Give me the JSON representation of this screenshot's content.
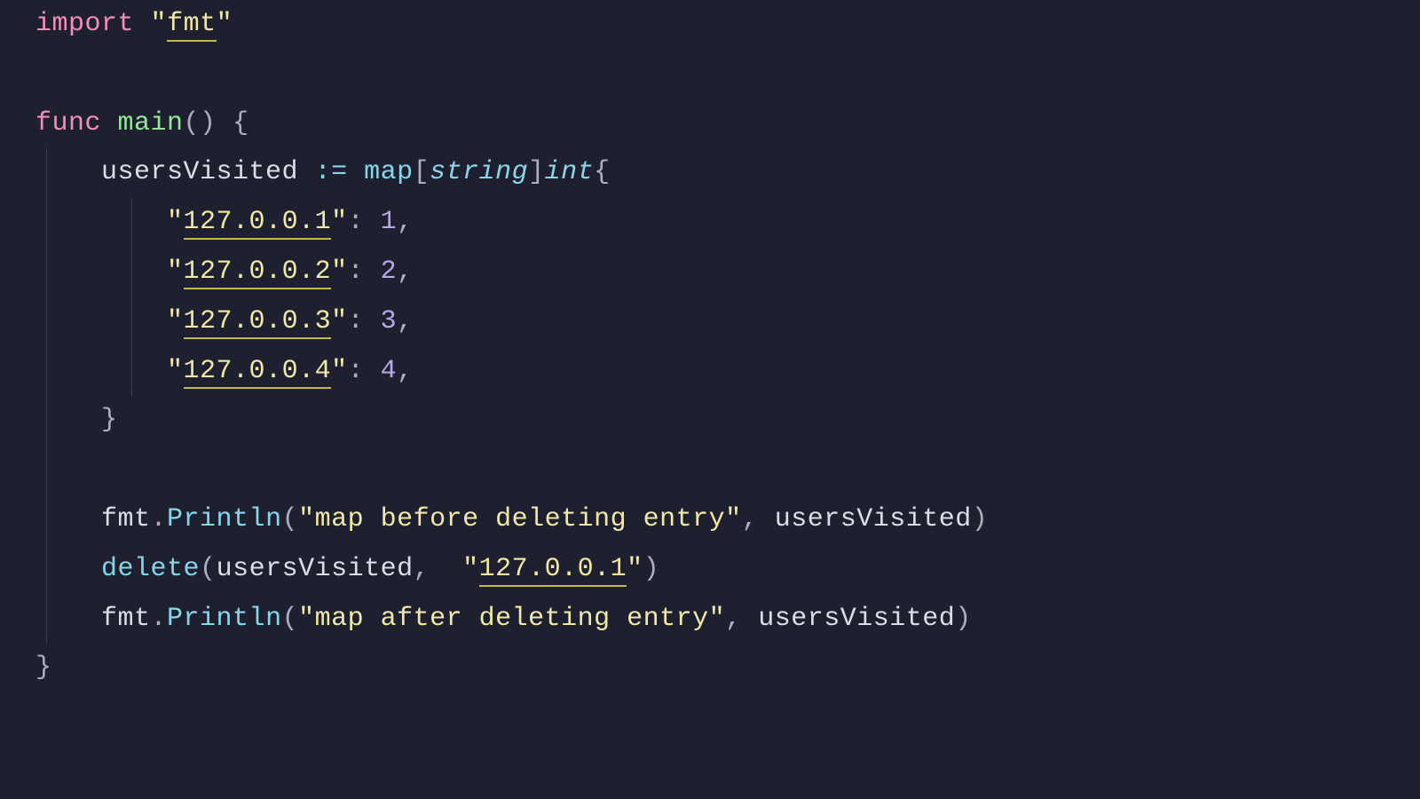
{
  "code": {
    "line1": {
      "import": "import",
      "q1": "\"",
      "fmt": "fmt",
      "q2": "\""
    },
    "line2_empty": "",
    "line3": {
      "func": "func",
      "main": "main",
      "parens": "()",
      "brace": " {"
    },
    "line4": {
      "indent": "    ",
      "var": "usersVisited",
      "op": " := ",
      "map": "map",
      "lbr": "[",
      "string": "string",
      "rbr": "]",
      "int": "int",
      "brace": "{"
    },
    "entries": [
      {
        "key": "127.0.0.1",
        "value": "1"
      },
      {
        "key": "127.0.0.2",
        "value": "2"
      },
      {
        "key": "127.0.0.3",
        "value": "3"
      },
      {
        "key": "127.0.0.4",
        "value": "4"
      }
    ],
    "line9": {
      "indent": "    ",
      "brace": "}"
    },
    "line10_empty": "",
    "line11": {
      "indent": "    ",
      "fmt": "fmt",
      "dot": ".",
      "println": "Println",
      "lpar": "(",
      "str": "\"map before deleting entry\"",
      "comma": ", ",
      "var": "usersVisited",
      "rpar": ")"
    },
    "line12": {
      "indent": "    ",
      "delete": "delete",
      "lpar": "(",
      "var": "usersVisited",
      "comma": ",  ",
      "q1": "\"",
      "key": "127.0.0.1",
      "q2": "\"",
      "rpar": ")"
    },
    "line13": {
      "indent": "    ",
      "fmt": "fmt",
      "dot": ".",
      "println": "Println",
      "lpar": "(",
      "str": "\"map after deleting entry\"",
      "comma": ", ",
      "var": "usersVisited",
      "rpar": ")"
    },
    "line14": {
      "brace": "}"
    },
    "entry_prefix": {
      "indent": "        ",
      "q": "\"",
      "colon": ": ",
      "comma": ","
    }
  }
}
